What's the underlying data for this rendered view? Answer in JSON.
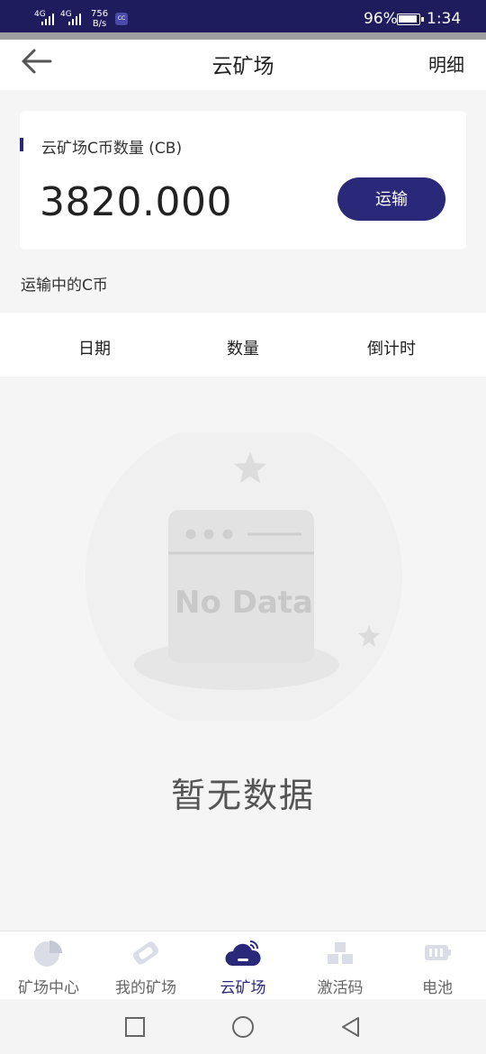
{
  "status_bar": {
    "net1": "4G",
    "net2": "4G",
    "speed_value": "756",
    "speed_unit": "B/s",
    "battery_percent": "96%",
    "time": "1:34",
    "icons": [
      "signal-icon",
      "battery-icon",
      "app-notification-icon"
    ]
  },
  "header": {
    "title": "云矿场",
    "right_action": "明细",
    "back_icon": "arrow-left-icon"
  },
  "balance_card": {
    "label": "云矿场C币数量 (CB)",
    "amount": "3820.000",
    "button_label": "运输"
  },
  "transit_section": {
    "title": "运输中的C币",
    "columns": [
      "日期",
      "数量",
      "倒计时"
    ],
    "rows": []
  },
  "empty_state": {
    "illustration_text": "No Data",
    "message": "暂无数据"
  },
  "tab_bar": {
    "active_index": 2,
    "tabs": [
      {
        "label": "矿场中心",
        "icon": "pie-chart-icon"
      },
      {
        "label": "我的矿场",
        "icon": "tag-icon"
      },
      {
        "label": "云矿场",
        "icon": "cloud-icon"
      },
      {
        "label": "激活码",
        "icon": "blocks-icon"
      },
      {
        "label": "电池",
        "icon": "battery-icon"
      }
    ]
  },
  "system_nav": {
    "buttons": [
      "recent-apps-icon",
      "home-icon",
      "back-triangle-icon"
    ]
  },
  "colors": {
    "accent": "#2a2878",
    "status_bar": "#1f1c5e",
    "background": "#f5f5f5"
  }
}
